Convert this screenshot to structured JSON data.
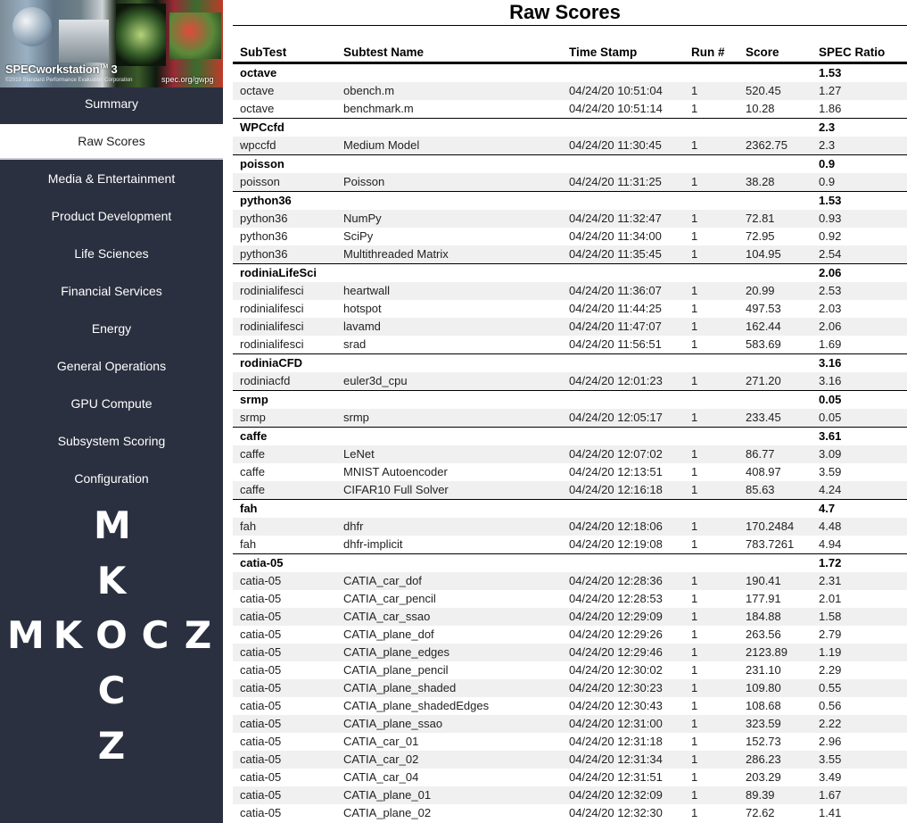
{
  "banner": {
    "product": "SPECworkstation",
    "version": "3",
    "tm": "TM",
    "copyright": "©2019 Standard Performance Evaluation Corporation",
    "url": "spec.org/gwpg"
  },
  "nav": {
    "items": [
      {
        "label": "Summary"
      },
      {
        "label": "Raw Scores"
      },
      {
        "label": "Media & Entertainment"
      },
      {
        "label": "Product Development"
      },
      {
        "label": "Life Sciences"
      },
      {
        "label": "Financial Services"
      },
      {
        "label": "Energy"
      },
      {
        "label": "General Operations"
      },
      {
        "label": "GPU Compute"
      },
      {
        "label": "Subsystem Scoring"
      },
      {
        "label": "Configuration"
      }
    ],
    "active_index": 1
  },
  "logo": {
    "letters": [
      "M",
      "K",
      "M",
      "K",
      "O",
      "C",
      "Z",
      "C",
      "Z"
    ]
  },
  "page": {
    "title": "Raw Scores"
  },
  "table": {
    "headers": [
      "SubTest",
      "Subtest Name",
      "Time Stamp",
      "Run #",
      "Score",
      "SPEC Ratio"
    ],
    "groups": [
      {
        "name": "octave",
        "ratio": "1.53",
        "rows": [
          [
            "octave",
            "obench.m",
            "04/24/20 10:51:04",
            "1",
            "520.45",
            "1.27"
          ],
          [
            "octave",
            "benchmark.m",
            "04/24/20 10:51:14",
            "1",
            "10.28",
            "1.86"
          ]
        ]
      },
      {
        "name": "WPCcfd",
        "ratio": "2.3",
        "rows": [
          [
            "wpccfd",
            "Medium Model",
            "04/24/20 11:30:45",
            "1",
            "2362.75",
            "2.3"
          ]
        ]
      },
      {
        "name": "poisson",
        "ratio": "0.9",
        "rows": [
          [
            "poisson",
            "Poisson",
            "04/24/20 11:31:25",
            "1",
            "38.28",
            "0.9"
          ]
        ]
      },
      {
        "name": "python36",
        "ratio": "1.53",
        "rows": [
          [
            "python36",
            "NumPy",
            "04/24/20 11:32:47",
            "1",
            "72.81",
            "0.93"
          ],
          [
            "python36",
            "SciPy",
            "04/24/20 11:34:00",
            "1",
            "72.95",
            "0.92"
          ],
          [
            "python36",
            "Multithreaded Matrix",
            "04/24/20 11:35:45",
            "1",
            "104.95",
            "2.54"
          ]
        ]
      },
      {
        "name": "rodiniaLifeSci",
        "ratio": "2.06",
        "rows": [
          [
            "rodinialifesci",
            "heartwall",
            "04/24/20 11:36:07",
            "1",
            "20.99",
            "2.53"
          ],
          [
            "rodinialifesci",
            "hotspot",
            "04/24/20 11:44:25",
            "1",
            "497.53",
            "2.03"
          ],
          [
            "rodinialifesci",
            "lavamd",
            "04/24/20 11:47:07",
            "1",
            "162.44",
            "2.06"
          ],
          [
            "rodinialifesci",
            "srad",
            "04/24/20 11:56:51",
            "1",
            "583.69",
            "1.69"
          ]
        ]
      },
      {
        "name": "rodiniaCFD",
        "ratio": "3.16",
        "rows": [
          [
            "rodiniacfd",
            "euler3d_cpu",
            "04/24/20 12:01:23",
            "1",
            "271.20",
            "3.16"
          ]
        ]
      },
      {
        "name": "srmp",
        "ratio": "0.05",
        "rows": [
          [
            "srmp",
            "srmp",
            "04/24/20 12:05:17",
            "1",
            "233.45",
            "0.05"
          ]
        ]
      },
      {
        "name": "caffe",
        "ratio": "3.61",
        "rows": [
          [
            "caffe",
            "LeNet",
            "04/24/20 12:07:02",
            "1",
            "86.77",
            "3.09"
          ],
          [
            "caffe",
            "MNIST Autoencoder",
            "04/24/20 12:13:51",
            "1",
            "408.97",
            "3.59"
          ],
          [
            "caffe",
            "CIFAR10 Full Solver",
            "04/24/20 12:16:18",
            "1",
            "85.63",
            "4.24"
          ]
        ]
      },
      {
        "name": "fah",
        "ratio": "4.7",
        "rows": [
          [
            "fah",
            "dhfr",
            "04/24/20 12:18:06",
            "1",
            "170.2484",
            "4.48"
          ],
          [
            "fah",
            "dhfr-implicit",
            "04/24/20 12:19:08",
            "1",
            "783.7261",
            "4.94"
          ]
        ]
      },
      {
        "name": "catia-05",
        "ratio": "1.72",
        "rows": [
          [
            "catia-05",
            "CATIA_car_dof",
            "04/24/20 12:28:36",
            "1",
            "190.41",
            "2.31"
          ],
          [
            "catia-05",
            "CATIA_car_pencil",
            "04/24/20 12:28:53",
            "1",
            "177.91",
            "2.01"
          ],
          [
            "catia-05",
            "CATIA_car_ssao",
            "04/24/20 12:29:09",
            "1",
            "184.88",
            "1.58"
          ],
          [
            "catia-05",
            "CATIA_plane_dof",
            "04/24/20 12:29:26",
            "1",
            "263.56",
            "2.79"
          ],
          [
            "catia-05",
            "CATIA_plane_edges",
            "04/24/20 12:29:46",
            "1",
            "2123.89",
            "1.19"
          ],
          [
            "catia-05",
            "CATIA_plane_pencil",
            "04/24/20 12:30:02",
            "1",
            "231.10",
            "2.29"
          ],
          [
            "catia-05",
            "CATIA_plane_shaded",
            "04/24/20 12:30:23",
            "1",
            "109.80",
            "0.55"
          ],
          [
            "catia-05",
            "CATIA_plane_shadedEdges",
            "04/24/20 12:30:43",
            "1",
            "108.68",
            "0.56"
          ],
          [
            "catia-05",
            "CATIA_plane_ssao",
            "04/24/20 12:31:00",
            "1",
            "323.59",
            "2.22"
          ],
          [
            "catia-05",
            "CATIA_car_01",
            "04/24/20 12:31:18",
            "1",
            "152.73",
            "2.96"
          ],
          [
            "catia-05",
            "CATIA_car_02",
            "04/24/20 12:31:34",
            "1",
            "286.23",
            "3.55"
          ],
          [
            "catia-05",
            "CATIA_car_04",
            "04/24/20 12:31:51",
            "1",
            "203.29",
            "3.49"
          ],
          [
            "catia-05",
            "CATIA_plane_01",
            "04/24/20 12:32:09",
            "1",
            "89.39",
            "1.67"
          ],
          [
            "catia-05",
            "CATIA_plane_02",
            "04/24/20 12:32:30",
            "1",
            "72.62",
            "1.41"
          ]
        ]
      }
    ]
  }
}
